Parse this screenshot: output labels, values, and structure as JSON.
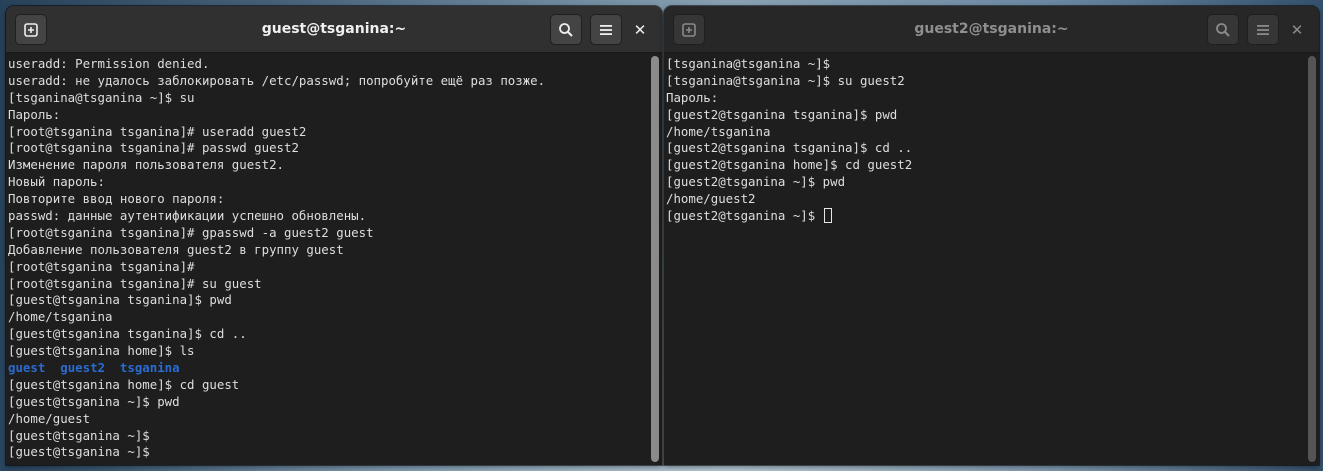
{
  "left_window": {
    "title": "guest@tsganina:~",
    "buttons": {
      "new_tab_icon": "new-tab-icon",
      "search_icon": "search-icon",
      "menu_icon": "hamburger-menu-icon",
      "close_glyph": "✕"
    },
    "lines": [
      "useradd: Permission denied.",
      "useradd: не удалось заблокировать /etc/passwd; попробуйте ещё раз позже.",
      "[tsganina@tsganina ~]$ su",
      "Пароль:",
      "[root@tsganina tsganina]# useradd guest2",
      "[root@tsganina tsganina]# passwd guest2",
      "Изменение пароля пользователя guest2.",
      "Новый пароль:",
      "Повторите ввод нового пароля:",
      "passwd: данные аутентификации успешно обновлены.",
      "[root@tsganina tsganina]# gpasswd -a guest2 guest",
      "Добавление пользователя guest2 в группу guest",
      "[root@tsganina tsganina]#",
      "[root@tsganina tsganina]# su guest",
      "[guest@tsganina tsganina]$ pwd",
      "/home/tsganina",
      "[guest@tsganina tsganina]$ cd ..",
      "[guest@tsganina home]$ ls",
      "",
      "[guest@tsganina home]$ cd guest",
      "[guest@tsganina ~]$ pwd",
      "/home/guest",
      "[guest@tsganina ~]$",
      "[guest@tsganina ~]$"
    ],
    "ls_output": [
      "guest",
      "guest2",
      "tsganina"
    ]
  },
  "right_window": {
    "title": "guest2@tsganina:~",
    "buttons": {
      "new_tab_icon": "new-tab-icon",
      "search_icon": "search-icon",
      "menu_icon": "hamburger-menu-icon",
      "close_glyph": "✕"
    },
    "lines": [
      "[tsganina@tsganina ~]$",
      "[tsganina@tsganina ~]$ su guest2",
      "Пароль:",
      "[guest2@tsganina tsganina]$ pwd",
      "/home/tsganina",
      "[guest2@tsganina tsganina]$ cd ..",
      "[guest2@tsganina home]$ cd guest2",
      "[guest2@tsganina ~]$ pwd",
      "/home/guest2",
      "[guest2@tsganina ~]$ "
    ]
  },
  "colors": {
    "terminal_bg": "#1e1e1e",
    "terminal_fg": "#dedede",
    "directory_blue": "#2a6bd1",
    "titlebar_active": "#303030",
    "titlebar_inactive": "#272727"
  }
}
